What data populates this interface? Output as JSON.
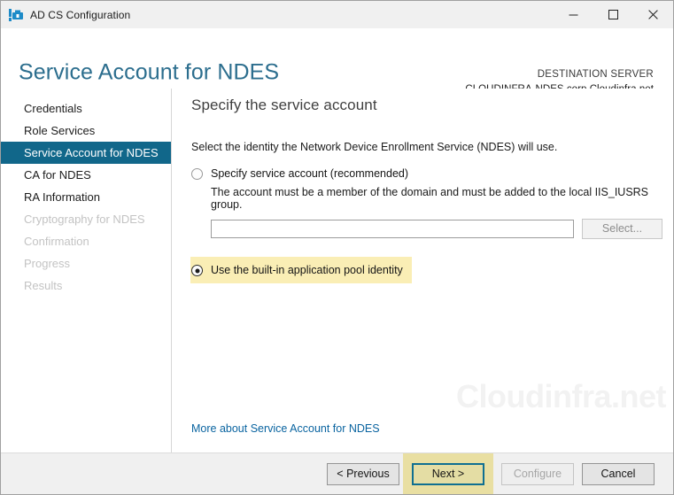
{
  "window": {
    "title": "AD CS Configuration",
    "icon": "server-manager-icon",
    "controls": {
      "minimize": "─",
      "maximize": "□",
      "close": "✕"
    }
  },
  "header": {
    "page_title": "Service Account for NDES",
    "destination_label": "DESTINATION SERVER",
    "destination_server": "CLOUDINFRA-NDES.corp.Cloudinfra.net"
  },
  "sidebar": {
    "items": [
      {
        "label": "Credentials",
        "state": "enabled"
      },
      {
        "label": "Role Services",
        "state": "enabled"
      },
      {
        "label": "Service Account for NDES",
        "state": "active"
      },
      {
        "label": "CA for NDES",
        "state": "enabled"
      },
      {
        "label": "RA Information",
        "state": "enabled"
      },
      {
        "label": "Cryptography for NDES",
        "state": "disabled"
      },
      {
        "label": "Confirmation",
        "state": "disabled"
      },
      {
        "label": "Progress",
        "state": "disabled"
      },
      {
        "label": "Results",
        "state": "disabled"
      }
    ]
  },
  "content": {
    "heading": "Specify the service account",
    "intro": "Select the identity the Network Device Enrollment Service (NDES) will use.",
    "option_specify": {
      "label": "Specify service account (recommended)",
      "checked": false,
      "hint": "The account must be a member of the domain and must be added to the local IIS_IUSRS group.",
      "input_value": "",
      "input_placeholder": "",
      "select_button_label": "Select...",
      "select_button_enabled": false
    },
    "option_builtin": {
      "label": "Use the built-in application pool identity",
      "checked": true,
      "highlight_color": "#faeeb5"
    },
    "more_link": "More about Service Account for NDES",
    "watermark": "Cloudinfra.net"
  },
  "footer": {
    "previous_label": "< Previous",
    "next_label": "Next >",
    "next_highlight_color": "#e9dfa2",
    "next_focus_border_color": "#0f6f91",
    "configure_label": "Configure",
    "configure_enabled": false,
    "cancel_label": "Cancel"
  },
  "colors": {
    "accent_teal": "#11678a",
    "title_blue": "#2c6e8e",
    "link_blue": "#0a64a0",
    "highlight_yellow": "#faeeb5"
  }
}
